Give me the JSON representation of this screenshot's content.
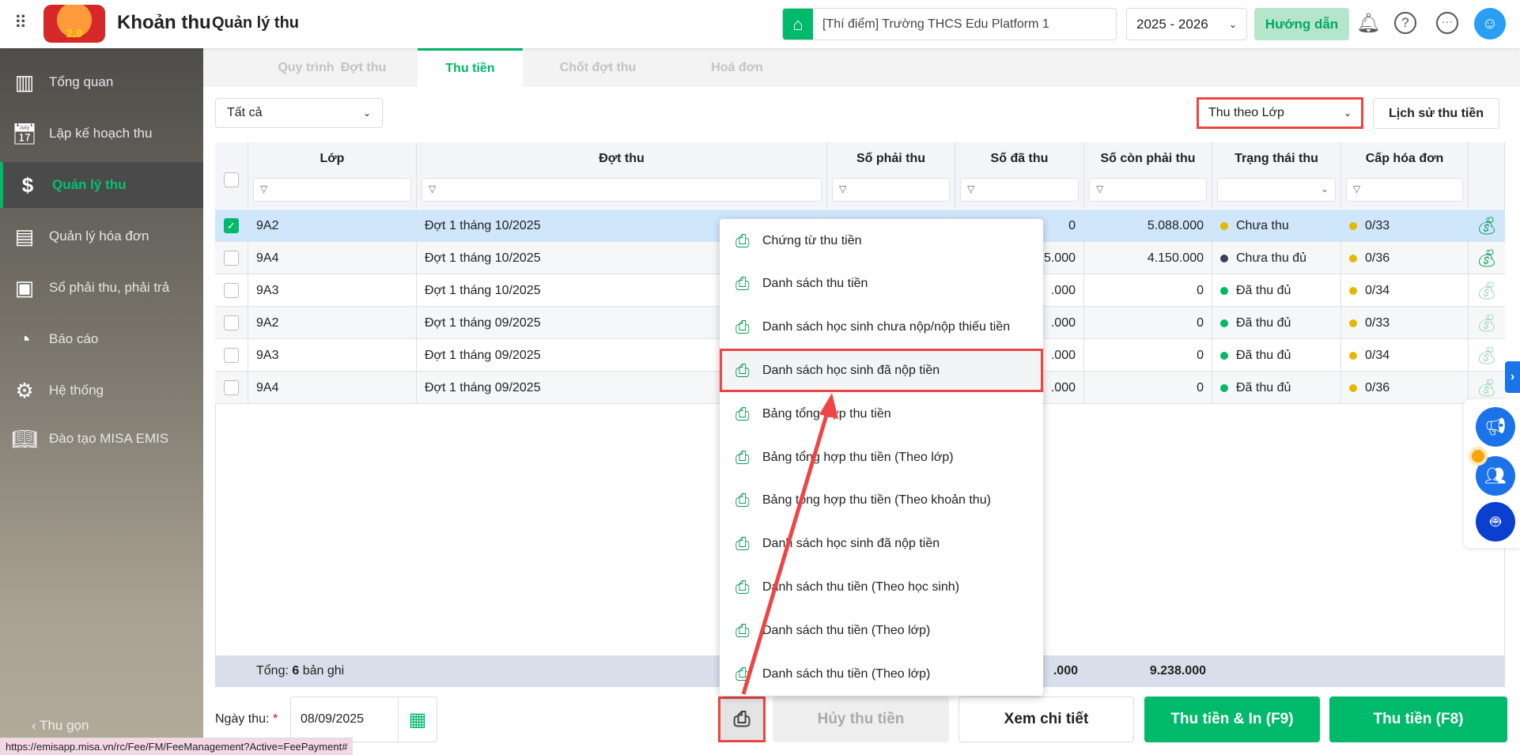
{
  "header": {
    "app_title": "Khoản thu",
    "page_title": "Quản lý thu",
    "school": "[Thí điểm] Trường THCS Edu Platform 1",
    "year": "2025 - 2026",
    "guide_label": "Hướng dẫn",
    "logo_text": "2.9"
  },
  "sidebar": {
    "items": [
      {
        "label": "Tổng quan",
        "icon": "bar-chart-icon"
      },
      {
        "label": "Lập kế hoạch thu",
        "icon": "calendar-dollar-icon"
      },
      {
        "label": "Quản lý thu",
        "icon": "hand-coin-icon"
      },
      {
        "label": "Quản lý hóa đơn",
        "icon": "invoice-icon"
      },
      {
        "label": "Sổ phải thu, phải trả",
        "icon": "ledger-icon"
      },
      {
        "label": "Báo cáo",
        "icon": "pie-chart-icon"
      },
      {
        "label": "Hệ thống",
        "icon": "gear-icon"
      },
      {
        "label": "Đào tạo MISA EMIS",
        "icon": "book-icon"
      }
    ],
    "collapse_label": "Thu gọn"
  },
  "tabs": [
    "Quy trình",
    "Đợt thu",
    "Thu tiền",
    "Chốt đợt thu",
    "Hoá đơn"
  ],
  "toolbar": {
    "filter_value": "Tất cả",
    "mode_value": "Thu theo Lớp",
    "history_label": "Lịch sử thu tiền"
  },
  "table": {
    "columns": [
      "Lớp",
      "Đợt thu",
      "Số phải thu",
      "Số đã thu",
      "Số còn phải thu",
      "Trạng thái thu",
      "Cấp hóa đơn"
    ],
    "rows": [
      {
        "lop": "9A2",
        "dot": "Đợt 1 tháng 10/2025",
        "phai": "",
        "da": "0",
        "con": "5.088.000",
        "status": "Chưa thu",
        "status_color": "#e6b800",
        "hd": "0/33",
        "selected": true
      },
      {
        "lop": "9A4",
        "dot": "Đợt 1 tháng 10/2025",
        "phai": "",
        "da": "5.000",
        "con": "4.150.000",
        "status": "Chưa thu đủ",
        "status_color": "#3f3f5a",
        "hd": "0/36",
        "selected": false
      },
      {
        "lop": "9A3",
        "dot": "Đợt 1 tháng 10/2025",
        "phai": "",
        "da": ".000",
        "con": "0",
        "status": "Đã thu đủ",
        "status_color": "#00b96b",
        "hd": "0/34",
        "selected": false
      },
      {
        "lop": "9A2",
        "dot": "Đợt 1 tháng 09/2025",
        "phai": "",
        "da": ".000",
        "con": "0",
        "status": "Đã thu đủ",
        "status_color": "#00b96b",
        "hd": "0/33",
        "selected": false
      },
      {
        "lop": "9A3",
        "dot": "Đợt 1 tháng 09/2025",
        "phai": "",
        "da": ".000",
        "con": "0",
        "status": "Đã thu đủ",
        "status_color": "#00b96b",
        "hd": "0/34",
        "selected": false
      },
      {
        "lop": "9A4",
        "dot": "Đợt 1 tháng 09/2025",
        "phai": "",
        "da": ".000",
        "con": "0",
        "status": "Đã thu đủ",
        "status_color": "#00b96b",
        "hd": "0/36",
        "selected": false
      }
    ],
    "footer": {
      "label_prefix": "Tổng: ",
      "count": "6",
      "label_suffix": " bản ghi",
      "da": ".000",
      "con": "9.238.000"
    }
  },
  "menu": {
    "items": [
      "Chứng từ thu tiền",
      "Danh sách thu tiền",
      "Danh sách học sinh chưa nộp/nộp thiếu tiền",
      "Danh sách học sinh đã nộp tiền",
      "Bảng tổng hợp thu tiền",
      "Bảng tổng hợp thu tiền (Theo lớp)",
      "Bảng tổng hợp thu tiền (Theo khoản thu)",
      "Danh sách học sinh đã nộp tiền",
      "Danh sách thu tiền (Theo học sinh)",
      "Danh sách thu tiền (Theo lớp)",
      "Danh sách thu tiền (Theo lớp)"
    ],
    "highlighted": 3
  },
  "bottom": {
    "date_label": "Ngày thu:",
    "required": "*",
    "date_value": "08/09/2025",
    "cancel_label": "Hủy thu tiền",
    "detail_label": "Xem chi tiết",
    "collect_print_label": "Thu tiền & In (F9)",
    "collect_label": "Thu tiền (F8)"
  },
  "status_url": "https://emisapp.misa.vn/rc/Fee/FM/FeeManagement?Active=FeePayment#",
  "colors": {
    "accent": "#00b96b",
    "highlight": "#ef4444",
    "selected_row": "#cfe6fb",
    "blue": "#1a73e8"
  }
}
